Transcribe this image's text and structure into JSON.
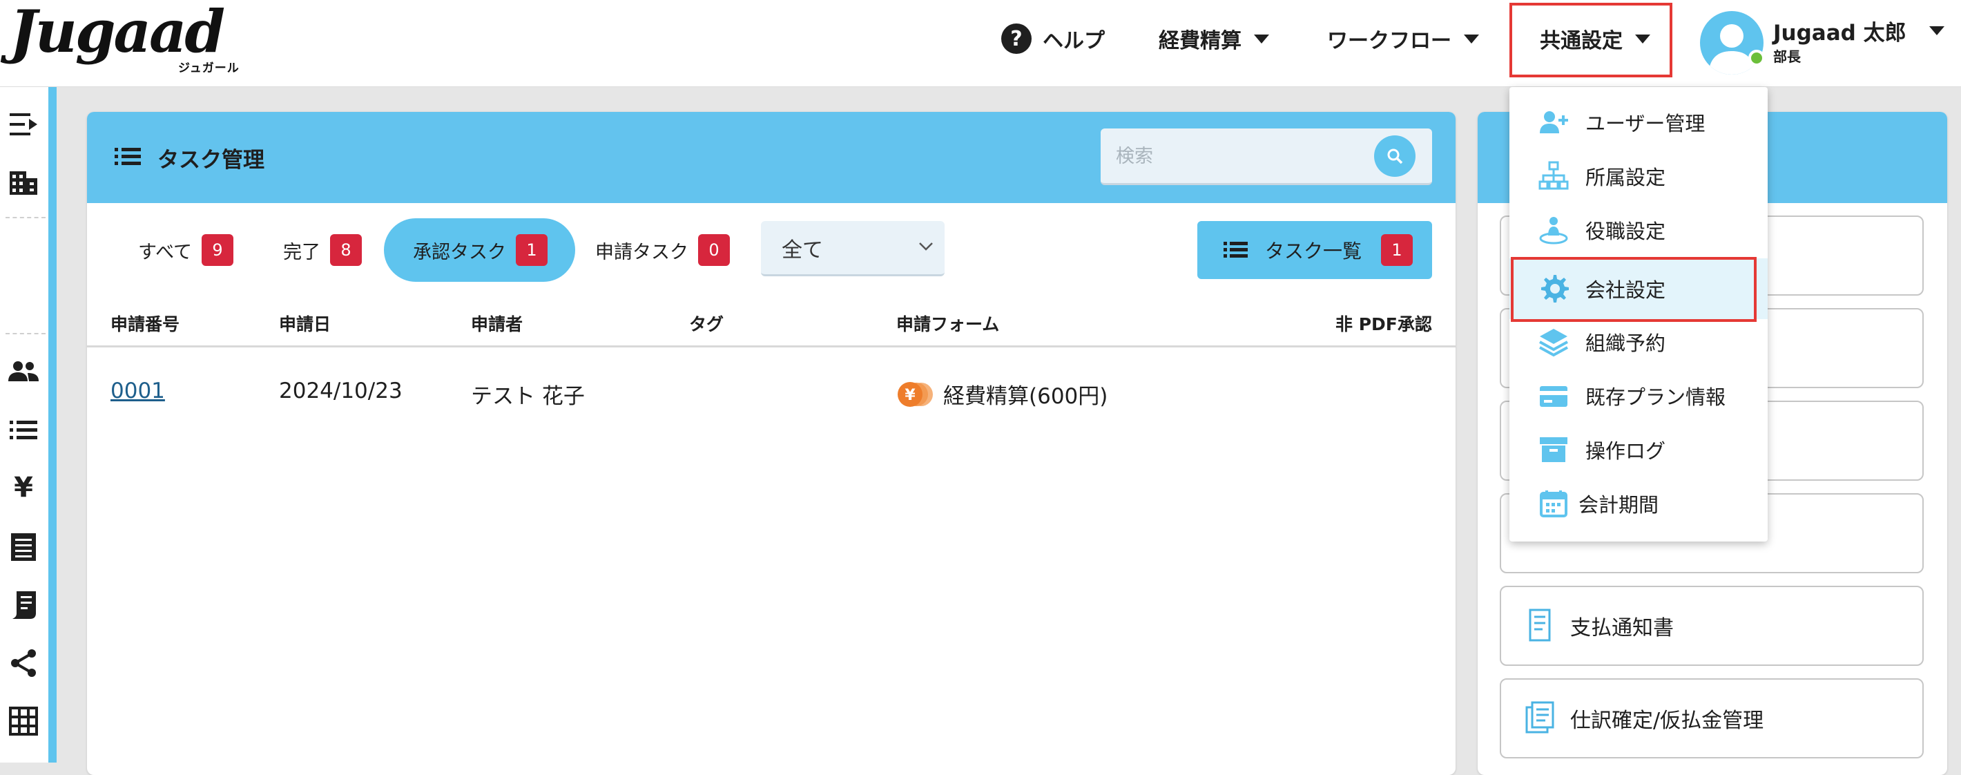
{
  "header": {
    "logo_text": "Jugaad",
    "logo_sub": "ジュガール",
    "nav": {
      "help": "ヘルプ",
      "expense": "経費精算",
      "workflow": "ワークフロー",
      "common": "共通設定"
    },
    "user": {
      "name": "Jugaad 太郎",
      "role": "部長"
    }
  },
  "card": {
    "title": "タスク管理",
    "search_placeholder": "検索",
    "filters": [
      {
        "label": "すべて",
        "count": "9"
      },
      {
        "label": "完了",
        "count": "8"
      },
      {
        "label": "承認タスク",
        "count": "1"
      },
      {
        "label": "申請タスク",
        "count": "0"
      }
    ],
    "select_value": "全て",
    "tasklist_label": "タスク一覧",
    "tasklist_count": "1",
    "columns": [
      "申請番号",
      "申請日",
      "申請者",
      "タグ",
      "申請フォーム",
      "非 PDF承認"
    ],
    "rows": [
      {
        "number": "0001",
        "date": "2024/10/23",
        "applicant": "テスト 花子",
        "tag": "",
        "form": "経費精算(600円)"
      }
    ]
  },
  "menu": {
    "items": [
      {
        "label": "ユーザー管理",
        "icon": "user-plus-icon"
      },
      {
        "label": "所属設定",
        "icon": "org-tree-icon"
      },
      {
        "label": "役職設定",
        "icon": "position-icon"
      },
      {
        "label": "会社設定",
        "icon": "gear-icon"
      },
      {
        "label": "組織予約",
        "icon": "layers-icon"
      },
      {
        "label": "既存プラン情報",
        "icon": "credit-card-icon"
      },
      {
        "label": "操作ログ",
        "icon": "archive-icon"
      },
      {
        "label": "会計期間",
        "icon": "calendar-icon"
      }
    ]
  },
  "right_panel": {
    "buttons": [
      {
        "label": "支払通知書",
        "icon": "receipt-icon"
      },
      {
        "label": "仕訳確定/仮払金管理",
        "icon": "journal-icon"
      }
    ]
  },
  "colors": {
    "accent": "#5fc4ee",
    "badge": "#d7263d",
    "highlight_border": "#e53935"
  }
}
